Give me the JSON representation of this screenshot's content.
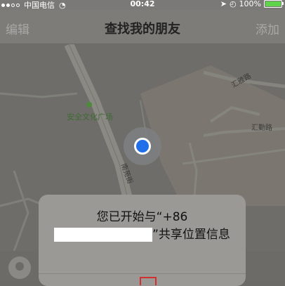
{
  "status_bar": {
    "carrier": "中国电信",
    "time": "00:42",
    "battery_percent": "100%",
    "signal_icon": "signal-dots-icon",
    "wifi_icon": "wifi-icon",
    "location_icon": "location-arrow-icon",
    "alarm_icon": "alarm-icon",
    "battery_icon": "battery-full-icon",
    "battery_color": "#5fd44a"
  },
  "nav": {
    "left_button": "编辑",
    "title": "查找我的朋友",
    "right_button": "添加"
  },
  "map": {
    "park_name": "安全文化广场",
    "road_1": "汇雅路",
    "road_2": "汇勤路",
    "road_3": "南苑街",
    "user_dot_color": "#1f6fe8"
  },
  "dialog": {
    "message_part1": "您已开始与“+86",
    "message_part2": "”共享位置信息"
  }
}
